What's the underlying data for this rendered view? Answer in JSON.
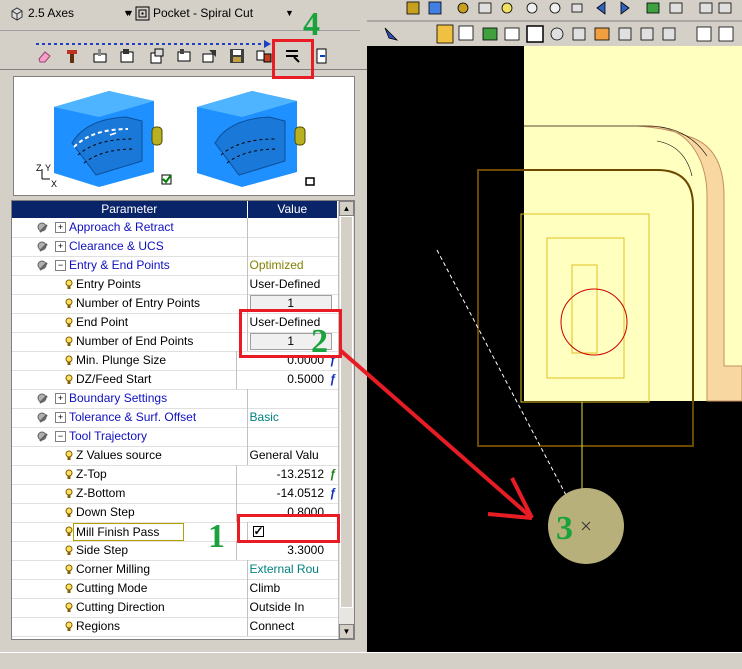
{
  "toolbar": {
    "axes_label": "2.5 Axes",
    "strategy_label": "Pocket - Spiral Cut"
  },
  "grid": {
    "header_param": "Parameter",
    "header_value": "Value",
    "rows": [
      {
        "label": "Approach & Retract",
        "value": "",
        "kind": "group",
        "expander": "+"
      },
      {
        "label": "Clearance & UCS",
        "value": "",
        "kind": "group",
        "expander": "+"
      },
      {
        "label": "Entry & End Points",
        "value": "Optimized",
        "kind": "group",
        "expander": "−"
      },
      {
        "label": "Entry Points",
        "value": "User-Defined",
        "kind": "leaf"
      },
      {
        "label": "Number of Entry Points",
        "value": "1",
        "kind": "leaf"
      },
      {
        "label": "End Point",
        "value": "User-Defined",
        "kind": "leaf"
      },
      {
        "label": "Number of End Points",
        "value": "1",
        "kind": "leaf"
      },
      {
        "label": "Min. Plunge Size",
        "value": "0.0000",
        "kind": "leaf"
      },
      {
        "label": "DZ/Feed Start",
        "value": "0.5000",
        "kind": "leaf"
      },
      {
        "label": "Boundary Settings",
        "value": "",
        "kind": "group",
        "expander": "+"
      },
      {
        "label": "Tolerance & Surf. Offset",
        "value": "Basic",
        "kind": "group",
        "expander": "+"
      },
      {
        "label": "Tool Trajectory",
        "value": "",
        "kind": "group",
        "expander": "−"
      },
      {
        "label": "Z Values source",
        "value": "General Valu",
        "kind": "leaf"
      },
      {
        "label": "Z-Top",
        "value": "-13.2512",
        "kind": "leaf"
      },
      {
        "label": "Z-Bottom",
        "value": "-14.0512",
        "kind": "leaf"
      },
      {
        "label": "Down Step",
        "value": "0.8000",
        "kind": "leaf"
      },
      {
        "label": "Mill Finish Pass",
        "value": "✓",
        "kind": "leaf"
      },
      {
        "label": "Side Step",
        "value": "3.3000",
        "kind": "leaf"
      },
      {
        "label": "Corner Milling",
        "value": "External Rou",
        "kind": "leaf"
      },
      {
        "label": "Cutting Mode",
        "value": "Climb",
        "kind": "leaf"
      },
      {
        "label": "Cutting Direction",
        "value": "Outside In",
        "kind": "leaf"
      },
      {
        "label": "Regions",
        "value": "Connect",
        "kind": "leaf"
      }
    ]
  },
  "annotations": {
    "n1": "1",
    "n2": "2",
    "n3": "3",
    "n4": "4"
  },
  "colors": {
    "accent": "#0a246a",
    "annotation_green": "#1aa33c",
    "annotation_red": "#e81c24",
    "part_fill": "#ffffc0"
  }
}
